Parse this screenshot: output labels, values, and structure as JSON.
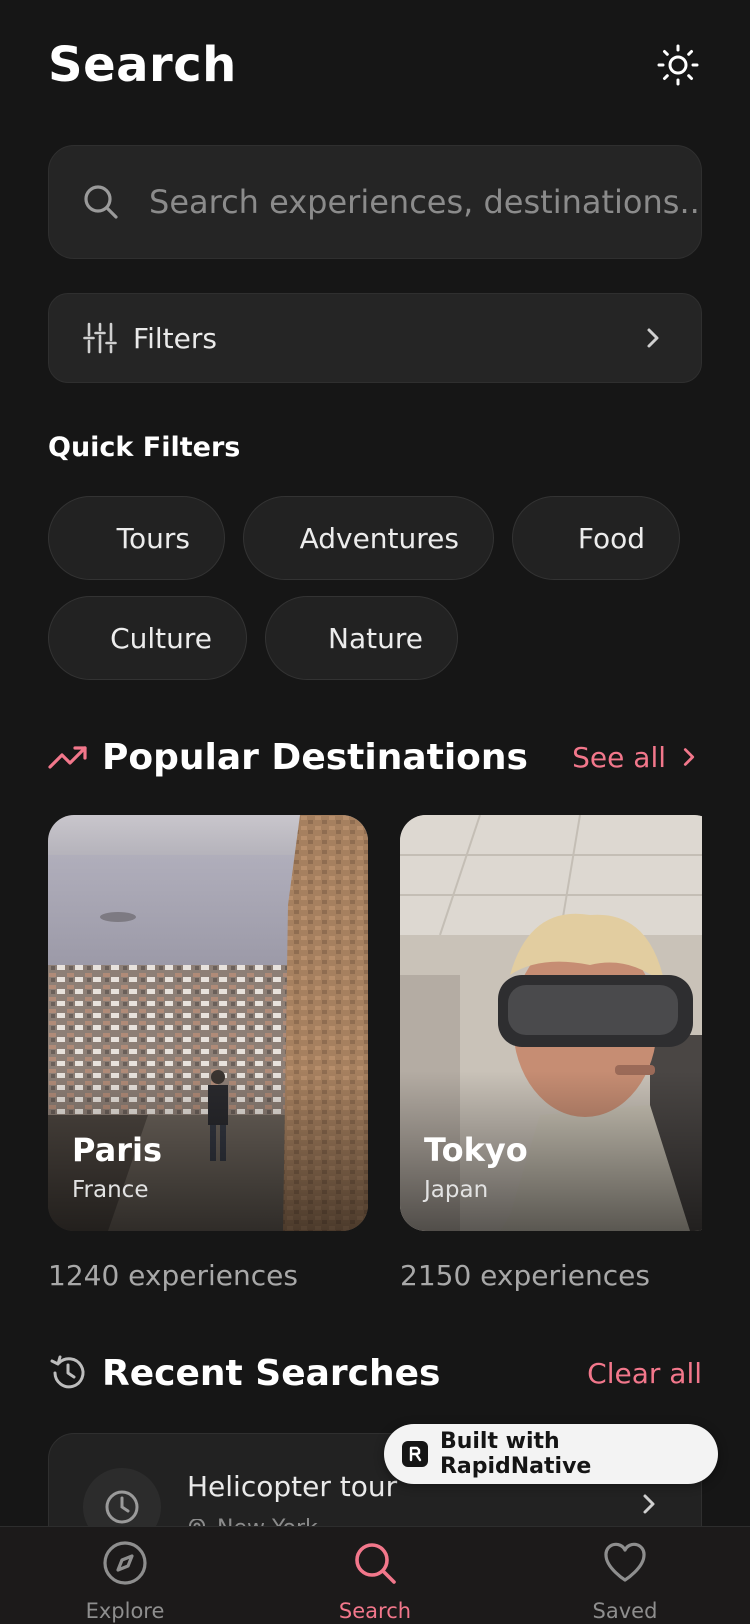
{
  "header": {
    "title": "Search"
  },
  "search": {
    "placeholder": "Search experiences, destinations..."
  },
  "filters": {
    "label": "Filters"
  },
  "quick_filters": {
    "title": "Quick Filters",
    "items": [
      "Tours",
      "Adventures",
      "Food",
      "Culture",
      "Nature"
    ]
  },
  "popular": {
    "title": "Popular Destinations",
    "see_all": "See all",
    "destinations": [
      {
        "city": "Paris",
        "country": "France",
        "count": "1240 experiences"
      },
      {
        "city": "Tokyo",
        "country": "Japan",
        "count": "2150 experiences"
      }
    ]
  },
  "recent": {
    "title": "Recent Searches",
    "clear": "Clear all",
    "items": [
      {
        "title": "Helicopter tour",
        "location": "New York"
      }
    ]
  },
  "badge": {
    "text": "Built with RapidNative"
  },
  "tabs": [
    {
      "label": "Explore",
      "icon": "compass-icon"
    },
    {
      "label": "Search",
      "icon": "search-icon"
    },
    {
      "label": "Saved",
      "icon": "heart-icon"
    }
  ],
  "colors": {
    "accent": "#f2778b",
    "background": "#161616",
    "surface": "#252525"
  }
}
